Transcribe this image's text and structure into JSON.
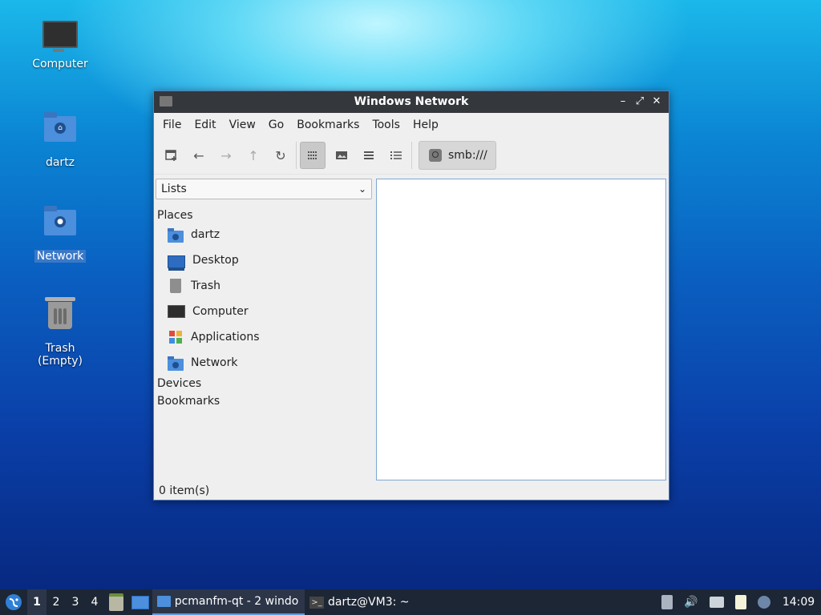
{
  "desktop": {
    "icons": [
      {
        "label": "Computer",
        "icon": "computer-icon"
      },
      {
        "label": "dartz",
        "icon": "home-folder-icon"
      },
      {
        "label": "Network",
        "icon": "network-folder-icon",
        "selected": true
      },
      {
        "label": "Trash (Empty)",
        "icon": "trash-icon"
      }
    ]
  },
  "window": {
    "title": "Windows Network",
    "controls": {
      "minimize": "–",
      "maximize": "⤢",
      "close": "✕"
    },
    "menu": [
      "File",
      "Edit",
      "View",
      "Go",
      "Bookmarks",
      "Tools",
      "Help"
    ],
    "toolbar": {
      "buttons": [
        "new-tab-icon",
        "back-icon",
        "forward-icon",
        "up-icon",
        "reload-icon",
        "icon-view-icon",
        "thumbnail-view-icon",
        "compact-view-icon",
        "detailed-list-icon"
      ],
      "path": "smb:///"
    },
    "side_panel": {
      "mode": "Lists",
      "places_header": "Places",
      "places": [
        "dartz",
        "Desktop",
        "Trash",
        "Computer",
        "Applications",
        "Network"
      ],
      "devices_header": "Devices",
      "bookmarks_header": "Bookmarks"
    },
    "status": "0 item(s)"
  },
  "taskbar": {
    "workspaces": [
      "1",
      "2",
      "3",
      "4"
    ],
    "tasks": [
      "pcmanfm-qt - 2 windo…",
      "dartz@VM3: ~"
    ],
    "clock": "14:09",
    "colors": {
      "panel": "#1d2634",
      "accent": "#5c9be0"
    }
  }
}
